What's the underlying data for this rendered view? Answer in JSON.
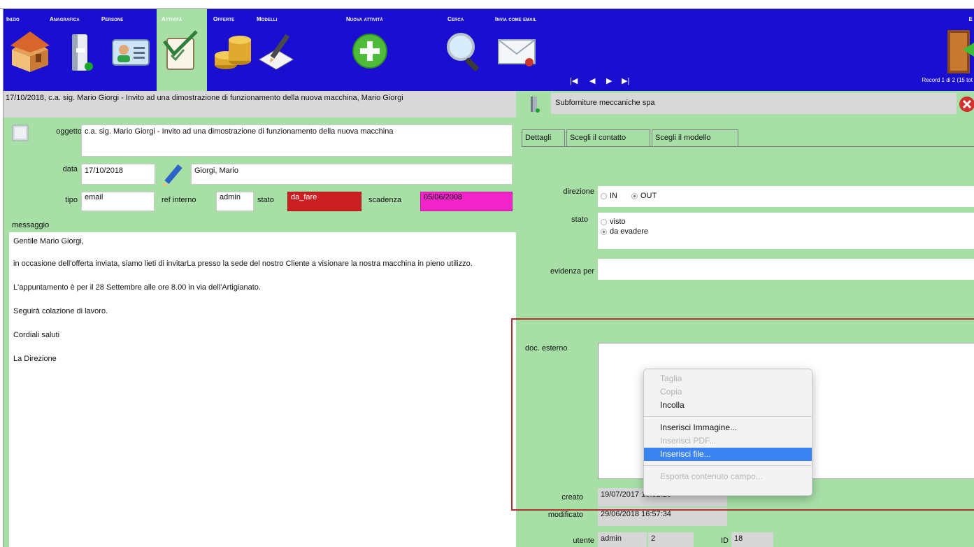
{
  "nav": {
    "inizio": "Inizio",
    "anagrafica": "Anagrafica",
    "persone": "Persone",
    "attivita": "Attività",
    "offerte": "Offerte",
    "modelli": "Modelli",
    "nuova_attivita": "Nuova attività",
    "cerca": "Cerca",
    "invia_email": "Invia come email",
    "exit": "E",
    "record_count": "Record 1 di 2 (15 tot"
  },
  "record_nav": {
    "first": "|◀",
    "prev": "◀",
    "next": "▶",
    "last": "▶|"
  },
  "record": {
    "title": "17/10/2018, c.a. sig. Mario Giorgi - Invito ad una dimostrazione di funzionamento della nuova macchina, Mario Giorgi",
    "oggetto_label": "oggetto",
    "oggetto": "c.a. sig. Mario Giorgi - Invito ad una dimostrazione di funzionamento della nuova macchina",
    "data_label": "data",
    "data": "17/10/2018",
    "contatto": "Giorgi, Mario",
    "tipo_label": "tipo",
    "tipo": "email",
    "ref_label": "ref interno",
    "ref": "admin",
    "stato_label": "stato",
    "stato": "da_fare",
    "scadenza_label": "scadenza",
    "scadenza": "05/06/2008",
    "messaggio_label": "messaggio",
    "messaggio": [
      "Gentile  Mario Giorgi,",
      "in occasione dell'offerta inviata, siamo lieti di invitarLa presso la sede del nostro Cliente a visionare la nostra macchina in pieno utilizzo.",
      "L'appuntamento è per il 28 Settembre alle ore 8.00 in via dell'Artigianato.",
      "Seguirà colazione di lavoro.",
      "Cordiali saluti",
      "La Direzione"
    ]
  },
  "right": {
    "company": "Subforniture meccaniche spa",
    "tabs": [
      "Dettagli",
      "Scegli il contatto",
      "Scegli il modello"
    ],
    "direzione_label": "direzione",
    "dir_in": "IN",
    "dir_out": "OUT",
    "stato_label": "stato",
    "stato_visto": "visto",
    "stato_evadere": "da evadere",
    "evidenza_label": "evidenza per",
    "doc_label": "doc. esterno",
    "creato_label": "creato",
    "creato": "19/07/2017 15:32:26",
    "modificato_label": "modificato",
    "modificato": "29/06/2018 16:57:34",
    "utente_label": "utente",
    "utente": "admin",
    "utente_id": "2",
    "id_label": "ID",
    "id": "18"
  },
  "context_menu": {
    "taglia": "Taglia",
    "copia": "Copia",
    "incolla": "Incolla",
    "immagine": "Inserisci Immagine...",
    "pdf": "Inserisci PDF...",
    "file": "Inserisci file...",
    "esporta": "Esporta contenuto campo..."
  },
  "colors": {
    "toolbar": "#1a0fd0",
    "panel": "#a7dfa7",
    "stato_bg": "#cc1f22",
    "scadenza_bg": "#f024c8",
    "menu_selected": "#3a83f0"
  },
  "icons": [
    "home-icon",
    "binder-icon",
    "contact-card-icon",
    "checklist-icon",
    "coins-icon",
    "pencil-paper-icon",
    "add-circle-icon",
    "magnifier-icon",
    "envelope-icon",
    "exit-door-icon",
    "pencil-icon",
    "note-icon",
    "close-icon"
  ]
}
